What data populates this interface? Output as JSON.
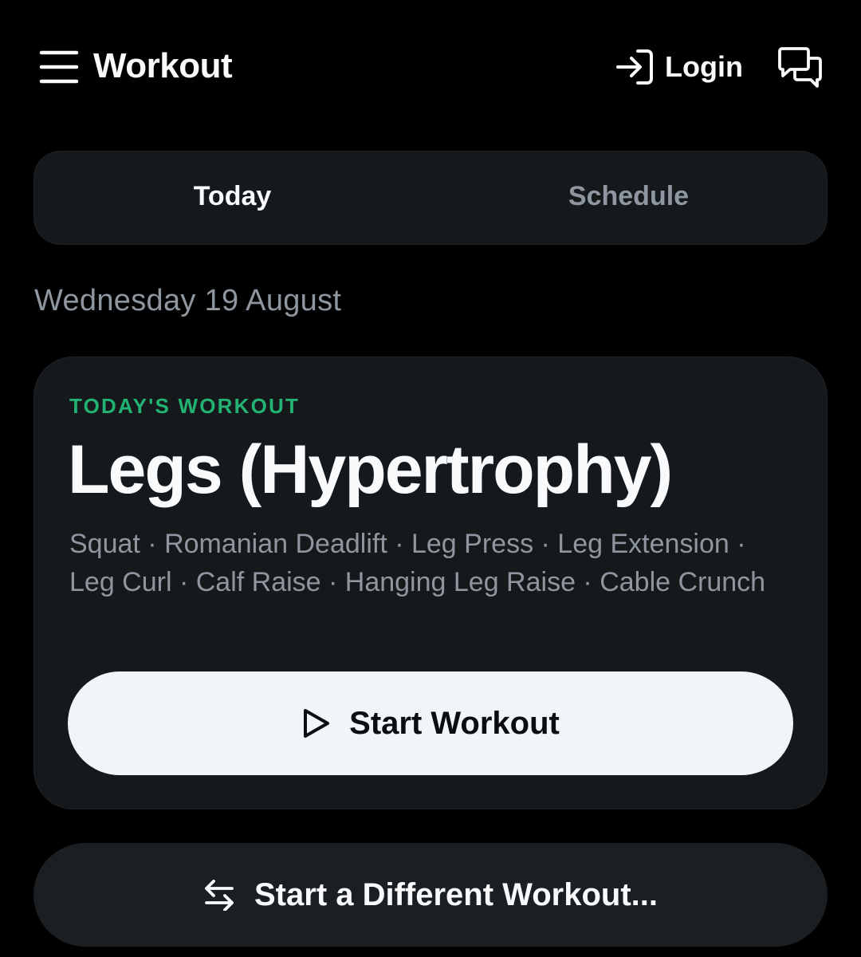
{
  "header": {
    "title": "Workout",
    "menu_icon": "hamburger-menu-icon",
    "login_label": "Login",
    "login_icon": "sign-in-icon",
    "chat_icon": "chat-bubbles-icon"
  },
  "tabs": [
    {
      "label": "Today",
      "active": true
    },
    {
      "label": "Schedule",
      "active": false
    }
  ],
  "date": "Wednesday 19 August",
  "card": {
    "eyebrow": "TODAY'S WORKOUT",
    "title": "Legs (Hypertrophy)",
    "exercises": "Squat · Romanian Deadlift · Leg Press · Leg Extension · Leg Curl · Calf Raise · Hanging Leg Raise · Cable Crunch",
    "start_label": "Start Workout",
    "start_icon": "play-icon"
  },
  "different_workout": {
    "label": "Start a Different Workout...",
    "icon": "swap-arrows-icon"
  },
  "colors": {
    "background": "#000000",
    "surface": "#16191c",
    "accent": "#22b373",
    "muted_text": "#8e969f",
    "primary_button": "#f1f5f9"
  }
}
